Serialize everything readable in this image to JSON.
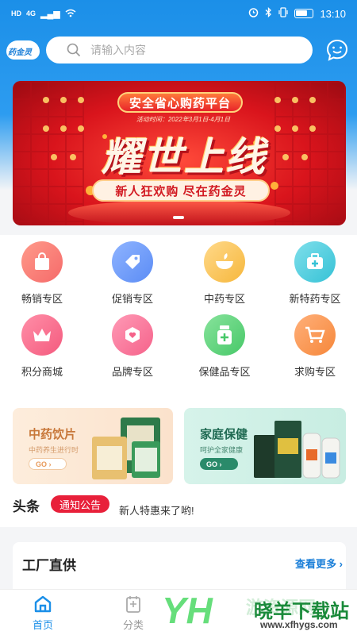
{
  "status_bar": {
    "network": "HD",
    "signal": "4G",
    "time": "13:10"
  },
  "header": {
    "logo_text": "药金灵",
    "search_placeholder": "请输入内容"
  },
  "banner": {
    "title": "安全省心购药平台",
    "date": "活动时间：2022年3月1日-4月1日",
    "headline": "耀世上线",
    "slogan": "新人狂欢购  尽在药金灵"
  },
  "categories": [
    {
      "label": "畅销专区",
      "icon": "shopping-bag-icon",
      "color": "#f56a6a"
    },
    {
      "label": "促销专区",
      "icon": "price-tag-icon",
      "color": "#5b8cf5"
    },
    {
      "label": "中药专区",
      "icon": "herbal-bowl-icon",
      "color": "#f6b73c"
    },
    {
      "label": "新特药专区",
      "icon": "medical-kit-icon",
      "color": "#36c2d6"
    },
    {
      "label": "积分商城",
      "icon": "crown-icon",
      "color": "#f45a7e"
    },
    {
      "label": "品牌专区",
      "icon": "heart-badge-icon",
      "color": "#f5628a"
    },
    {
      "label": "保健品专区",
      "icon": "medicine-bottle-icon",
      "color": "#47c868"
    },
    {
      "label": "求购专区",
      "icon": "shopping-cart-icon",
      "color": "#f6873a"
    }
  ],
  "promos": [
    {
      "title": "中药饮片",
      "subtitle": "中药养生进行时",
      "go": "GO",
      "bg": "#fde9d6",
      "accent": "#c8783a"
    },
    {
      "title": "家庭保健",
      "subtitle": "呵护全家健康",
      "go": "GO",
      "bg": "#d4f2ea",
      "accent": "#2a8a6a"
    }
  ],
  "news": {
    "title": "头条",
    "tag": "通知公告",
    "text": "新人特惠来了哟!"
  },
  "factory": {
    "title": "工厂直供",
    "more": "查看更多"
  },
  "tabs": [
    {
      "label": "首页",
      "icon": "home-icon",
      "active": true
    },
    {
      "label": "分类",
      "icon": "category-icon",
      "active": false
    }
  ],
  "watermark": {
    "brand": "晓羊下载站",
    "url": "www.xfhygs.com",
    "ghost": "游资源网"
  },
  "colors": {
    "primary": "#1b8fe8",
    "accent_red": "#e8203a"
  }
}
